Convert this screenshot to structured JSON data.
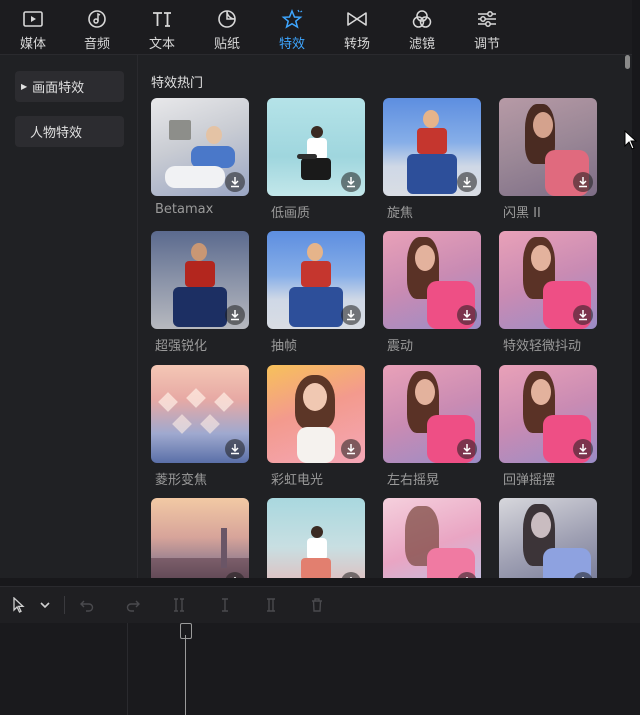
{
  "top_tabs": [
    {
      "label": "媒体",
      "icon": "media-icon"
    },
    {
      "label": "音频",
      "icon": "audio-icon"
    },
    {
      "label": "文本",
      "icon": "text-icon"
    },
    {
      "label": "贴纸",
      "icon": "sticker-icon"
    },
    {
      "label": "特效",
      "icon": "effects-icon",
      "active": true
    },
    {
      "label": "转场",
      "icon": "transition-icon"
    },
    {
      "label": "滤镜",
      "icon": "filter-icon"
    },
    {
      "label": "调节",
      "icon": "adjust-icon"
    }
  ],
  "sidebar": {
    "items": [
      {
        "label": "画面特效",
        "selected": true
      },
      {
        "label": "人物特效"
      }
    ]
  },
  "effects": {
    "section_title": "特效热门",
    "items": [
      {
        "name": "Betamax"
      },
      {
        "name": "低画质"
      },
      {
        "name": "旋焦"
      },
      {
        "name": "闪黑 II"
      },
      {
        "name": "超强锐化"
      },
      {
        "name": "抽帧"
      },
      {
        "name": "震动"
      },
      {
        "name": "特效轻微抖动"
      },
      {
        "name": "菱形变焦"
      },
      {
        "name": "彩虹电光"
      },
      {
        "name": "左右摇晃"
      },
      {
        "name": "回弹摇摆"
      },
      {
        "name": ""
      },
      {
        "name": ""
      },
      {
        "name": ""
      },
      {
        "name": ""
      }
    ]
  },
  "colors": {
    "accent": "#3ea6ff",
    "panel_bg": "#202124",
    "caption": "#9a9a9a"
  }
}
